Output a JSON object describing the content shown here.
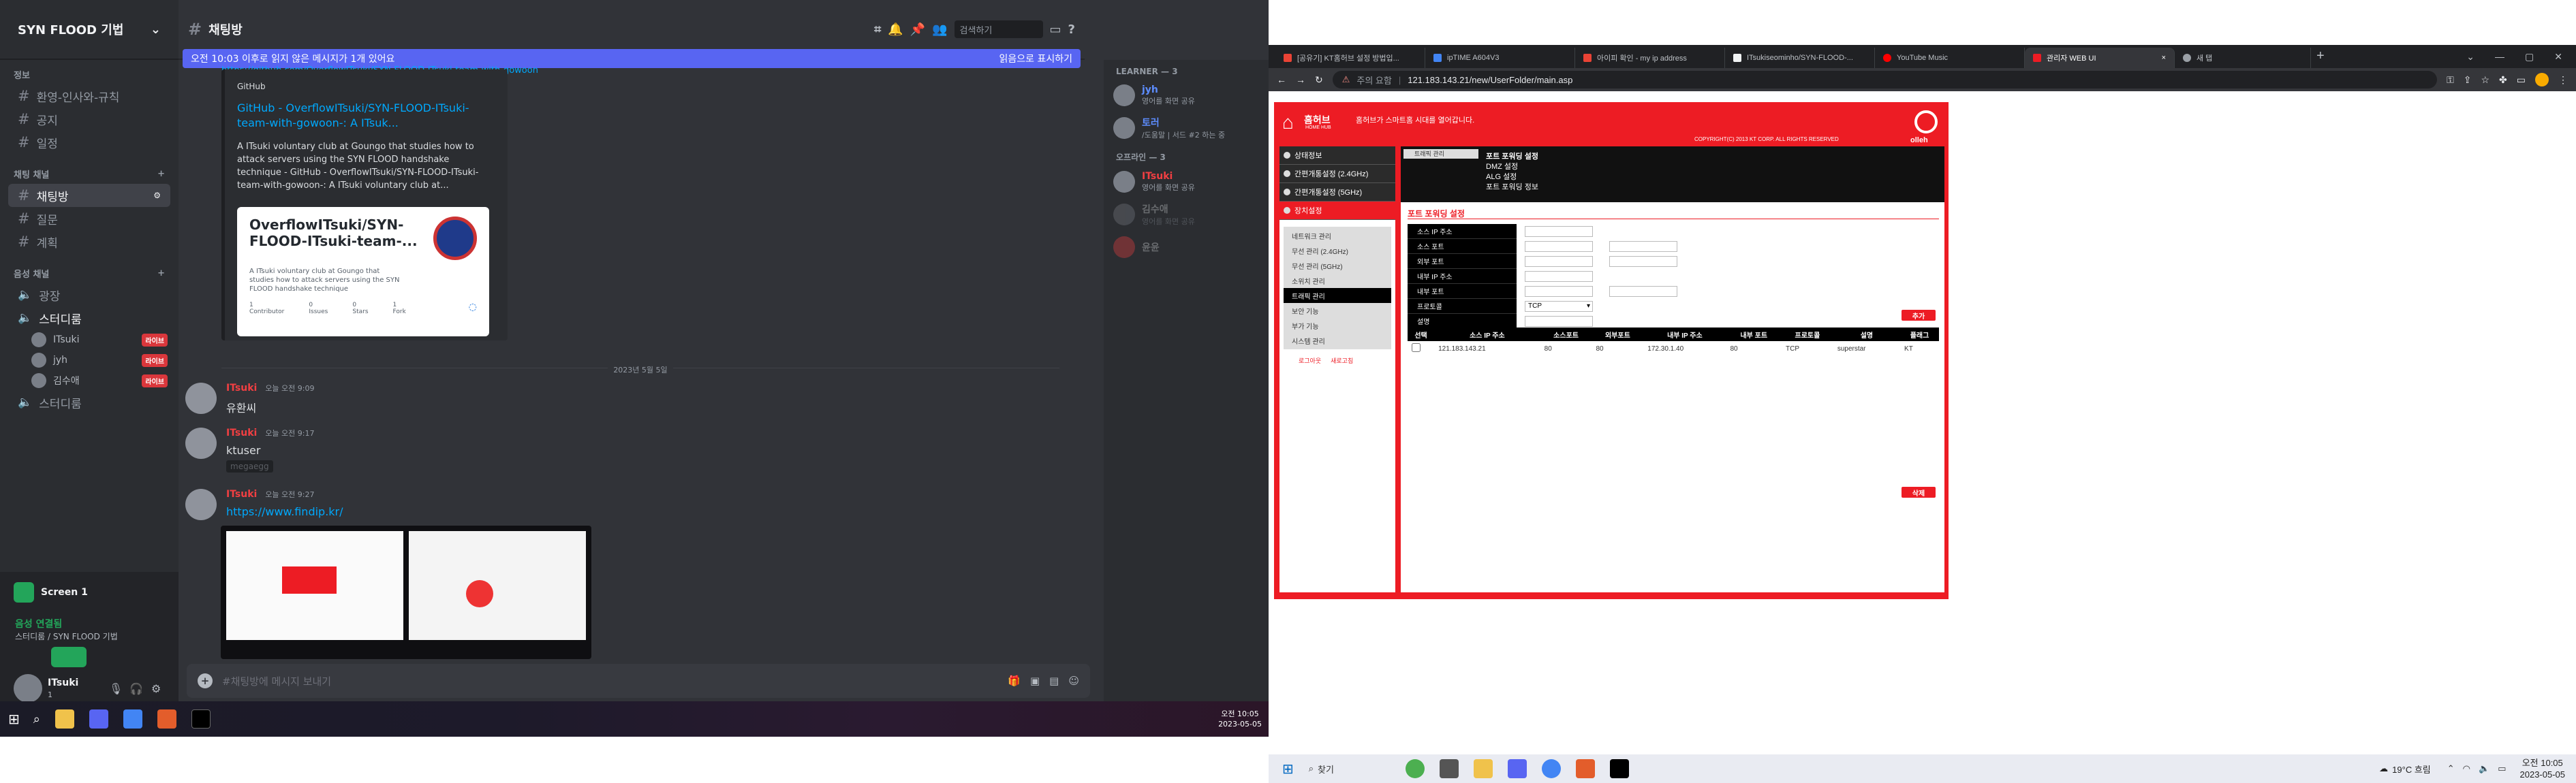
{
  "discord": {
    "server_name": "SYN FLOOD 기법",
    "categories": [
      "정보",
      "채팅 채널",
      "음성 채널"
    ],
    "info_channels": [
      "환영-인사와-규칙",
      "공지",
      "일정"
    ],
    "text_channels": [
      "채팅방",
      "질문",
      "계획"
    ],
    "voice_channels": [
      "광장",
      "스터디룸",
      "스터디룸"
    ],
    "voice_users": [
      {
        "name": "ITsuki",
        "badge": "라이브"
      },
      {
        "name": "jyh",
        "badge": "라이브"
      },
      {
        "name": "김수애",
        "badge": "라이브"
      }
    ],
    "channel_title": "채팅방",
    "search_placeholder": "검색하기",
    "banner_text": "오전 10:03 이후로 읽지 않은 메시지가 1개 있어요",
    "banner_action": "읽음으로 표시하기",
    "embed": {
      "link_top": "https://github.com/OverflowITsuki/SYN-FLOOD-ITsuki-team-with-gowoon",
      "provider": "GitHub",
      "title": "GitHub - OverflowITsuki/SYN-FLOOD-ITsuki-team-with-gowoon-: A ITsuk...",
      "description": "A ITsuki voluntary club at Goungo that studies how to attack servers using the SYN FLOOD handshake technique - GitHub - OverflowITsuki/SYN-FLOOD-ITsuki-team-with-gowoon-: A ITsuki voluntary club at...",
      "card_title": "OverflowITsuki/SYN-FLOOD-ITsuki-team-...",
      "card_desc": "A ITsuki voluntary club at Goungo that studies how to attack servers using the SYN FLOOD handshake technique",
      "stats": [
        {
          "n": "1",
          "label": "Contributor"
        },
        {
          "n": "0",
          "label": "Issues"
        },
        {
          "n": "0",
          "label": "Stars"
        },
        {
          "n": "1",
          "label": "Fork"
        }
      ]
    },
    "date_divider": "2023년 5월 5일",
    "messages": [
      {
        "author": "ITsuki",
        "time": "오늘 오전 9:09",
        "text": "유환씨"
      },
      {
        "author": "ITsuki",
        "time": "오늘 오전 9:17",
        "text": "ktuser",
        "spoiler": "megaegg"
      },
      {
        "author": "ITsuki",
        "time": "오늘 오전 9:27",
        "text": "https://www.findip.kr/"
      }
    ],
    "input_placeholder": "#채팅방에 메시지 보내기",
    "members": {
      "learner_header": "LEARNER — 3",
      "learners": [
        {
          "name": "jyh",
          "status": "영어를 화면 공유"
        },
        {
          "name": "토러",
          "status": "/도움말 | 서드 #2 하는 중"
        }
      ],
      "owner_header": "오프라인 — 3",
      "owners": [
        {
          "name": "ITsuki",
          "status": "영어를 화면 공유"
        },
        {
          "name": "김수애",
          "status": "영어를 화면 공유"
        },
        {
          "name": "윤윤",
          "status": ""
        }
      ]
    },
    "voice_panel": {
      "screen_label": "Screen 1",
      "connected": "음성 연결됨",
      "connected_where": "스터디룸 / SYN FLOOD 기법",
      "user": "ITsuki",
      "user_sub": "1"
    },
    "clock": {
      "time": "오전 10:05",
      "date": "2023-05-05"
    }
  },
  "browser": {
    "tabs": [
      {
        "title": "[공유기] KT홈허브 설정 방법입...",
        "color": "#ea4335"
      },
      {
        "title": "ipTIME A604V3",
        "color": "#4285f4"
      },
      {
        "title": "아이피 확인 - my ip address",
        "color": "#ea4335"
      },
      {
        "title": "ITsukiseominho/SYN-FLOOD-...",
        "color": "#f1f3f4"
      },
      {
        "title": "YouTube Music",
        "color": "#ff0000"
      },
      {
        "title": "관리자 WEB UI",
        "color": "#ed1c24"
      },
      {
        "title": "새 탭",
        "color": "#9aa0a6"
      }
    ],
    "security_label": "주의 요함",
    "url": "121.183.143.21/new/UserFolder/main.asp"
  },
  "webui": {
    "brand": "홈허브",
    "brand_sub": "HOME HUB",
    "slogan": "홈허브가 스마트홈 시대를 열어갑니다.",
    "copyright": "COPYRIGHT(C) 2013 KT CORP. ALL RIGHTS RESERVED",
    "olleh": "olleh",
    "sidebar": [
      "상태정보",
      "간편개통설정 (2.4GHz)",
      "간편개통설정 (5GHz)",
      "장치설정"
    ],
    "subnav": [
      "네트워크 관리",
      "무선 관리 (2.4GHz)",
      "무선 관리 (5GHz)",
      "소위치 관리",
      "트래픽 관리",
      "보안 기능",
      "부가 기능",
      "시스템 관리"
    ],
    "side_buttons": [
      "로그아웃",
      "새로고침"
    ],
    "top_tab": "트래픽 관리",
    "top_links": [
      "포트 포워딩 설정",
      "DMZ 설정",
      "ALG 설정",
      "포트 포워딩 정보"
    ],
    "section_title": "포트 포워딩 설정",
    "form_labels": [
      "소스 IP 주소",
      "소스 포트",
      "외부 포트",
      "내부 IP 주소",
      "내부 포트",
      "프로토콜",
      "설명"
    ],
    "protocol_value": "TCP",
    "add_button": "추가",
    "delete_button": "삭제",
    "table_headers": [
      "선택",
      "소스 IP 주소",
      "소스포트",
      "외부포트",
      "내부 IP 주소",
      "내부 포트",
      "프로토콜",
      "설명",
      "플래그"
    ],
    "table_rows": [
      [
        "",
        "121.183.143.21",
        "80",
        "80",
        "172.30.1.40",
        "80",
        "TCP",
        "superstar",
        "KT"
      ]
    ]
  },
  "taskbar2": {
    "search_placeholder": "찾기",
    "weather": "19°C 흐림",
    "time": "오전 10:05",
    "date": "2023-05-05"
  }
}
